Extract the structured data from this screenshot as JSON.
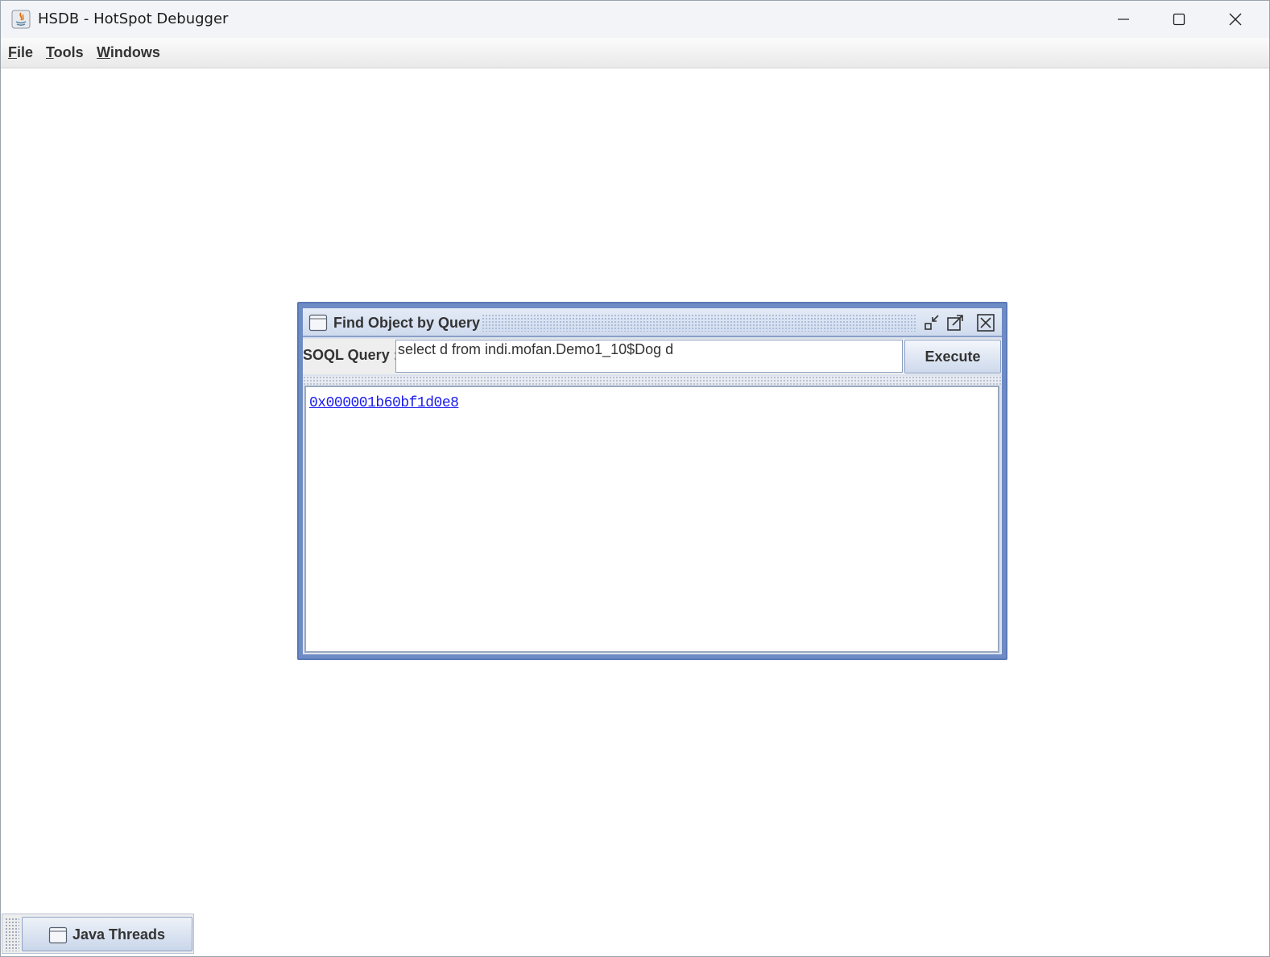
{
  "window": {
    "title": "HSDB - HotSpot Debugger",
    "icons": {
      "app": "java-icon",
      "minimize": "minimize-icon",
      "maximize": "maximize-icon",
      "close": "close-icon"
    }
  },
  "menubar": {
    "items": [
      {
        "mnemonic": "F",
        "rest": "ile"
      },
      {
        "mnemonic": "T",
        "rest": "ools"
      },
      {
        "mnemonic": "W",
        "rest": "indows"
      }
    ]
  },
  "find_dialog": {
    "title": "Find Object by Query",
    "icons": {
      "frame": "window-frame-icon",
      "iconify": "iconify-icon",
      "maximize": "maximize-icon",
      "close": "close-icon"
    },
    "query_label": "SOQL Query :",
    "query_value": "select d from indi.mofan.Demo1_10$Dog d",
    "execute_label": "Execute",
    "results": [
      "0x000001b60bf1d0e8"
    ]
  },
  "desktop_icons": [
    {
      "label": "Java Threads",
      "icon": "window-frame-icon"
    }
  ],
  "colors": {
    "frame_border": "#6d8bc4",
    "link": "#1a1aee"
  }
}
